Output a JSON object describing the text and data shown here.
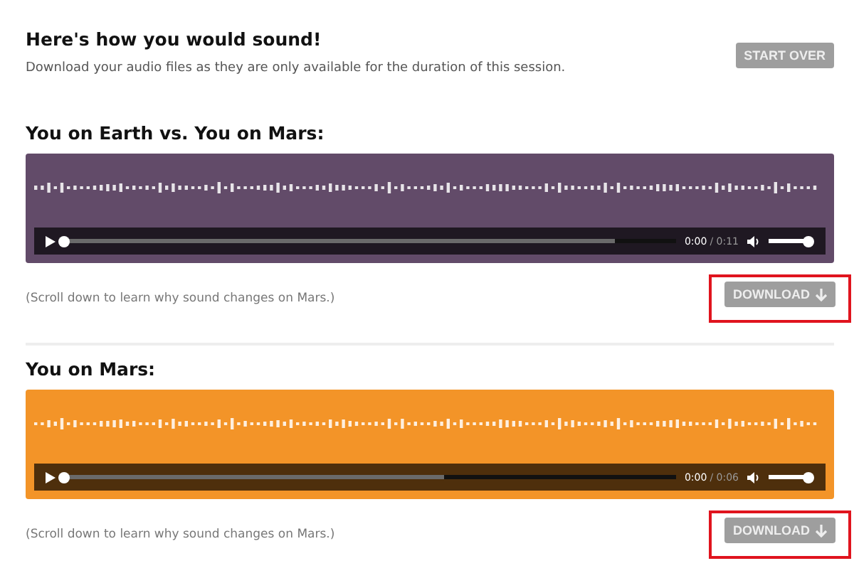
{
  "header": {
    "title": "Here's how you would sound!",
    "subtitle": "Download your audio files as they are only available for the duration of this session.",
    "button": "START OVER"
  },
  "sections": [
    {
      "title": "You on Earth vs. You on Mars:",
      "color": "#624b69",
      "player": {
        "level": 0,
        "buffer": {
          "level": 0.9
        },
        "time": "0:00",
        "duration": "/ 0:11",
        "volume": {
          "level": 1
        }
      },
      "caption": "(Scroll down to learn why sound changes on Mars.)",
      "download": "DOWNLOAD",
      "highlighted": true
    },
    {
      "title": "You on Mars:",
      "color": "#f39428",
      "player": {
        "level": 0,
        "buffer": {
          "level": 0.62
        },
        "time": "0:00",
        "duration": "/ 0:06",
        "volume": {
          "level": 1
        }
      },
      "caption": "(Scroll down to learn why sound changes on Mars.)",
      "download": "DOWNLOAD",
      "highlighted": true
    }
  ]
}
